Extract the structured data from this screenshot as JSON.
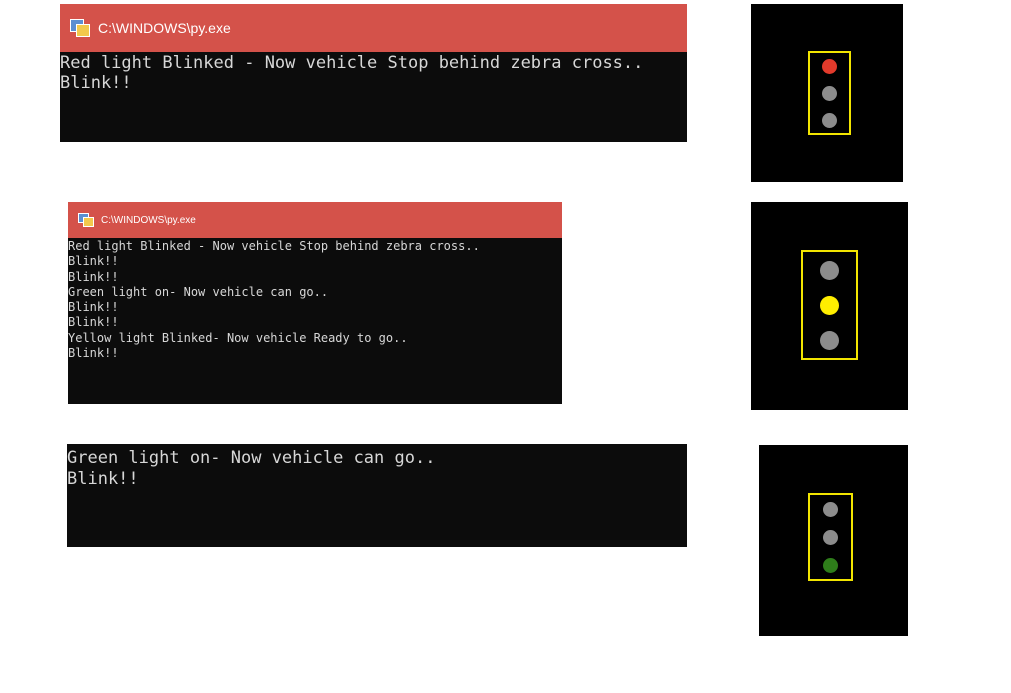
{
  "colors": {
    "titlebar_red": "#d4524a",
    "console_bg": "#0c0c0c",
    "console_text": "#d7d7d7",
    "frame_yellow": "#f2e500",
    "lamp_off": "#8c8c8c",
    "lamp_red": "#e23a2b",
    "lamp_yellow": "#ffee00",
    "lamp_green": "#2e7d1a"
  },
  "icons": {
    "console_app_icon": "python-console-icon"
  },
  "window1": {
    "title": "C:\\WINDOWS\\py.exe",
    "lines": [
      "Red light Blinked - Now vehicle Stop behind zebra cross..",
      "Blink!!"
    ]
  },
  "window2": {
    "title": "C:\\WINDOWS\\py.exe",
    "lines": [
      "Red light Blinked - Now vehicle Stop behind zebra cross..",
      "Blink!!",
      "Blink!!",
      "Green light on- Now vehicle can go..",
      "Blink!!",
      "Blink!!",
      "Yellow light Blinked- Now vehicle Ready to go..",
      "Blink!!"
    ]
  },
  "window3": {
    "lines": [
      "Green light on- Now vehicle can go..",
      "Blink!!"
    ]
  },
  "traffic_lights": [
    {
      "active": "red",
      "lamps": [
        "red",
        "off",
        "off"
      ]
    },
    {
      "active": "yellow",
      "lamps": [
        "off",
        "yellow",
        "off"
      ]
    },
    {
      "active": "green",
      "lamps": [
        "off",
        "off",
        "green"
      ]
    }
  ]
}
